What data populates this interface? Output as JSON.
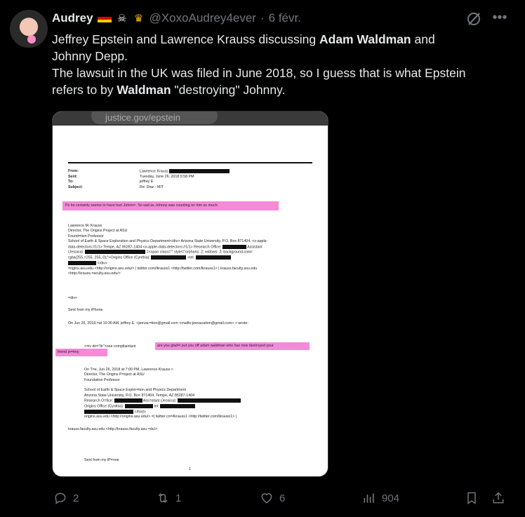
{
  "author": {
    "name": "Audrey",
    "handle": "@XoxoAudrey4ever",
    "separator": "·",
    "date": "6 févr.",
    "badge_emoji": [
      "german-flag",
      "pirate-flag",
      "crown"
    ]
  },
  "tweet_text": {
    "line1_a": "Jeffrey Epstein and Lawrence Krauss discussing ",
    "line1_bold": "Adam Waldman",
    "line1_b": " and",
    "line2": "Johnny Depp.",
    "line3": "The lawsuit in the UK was filed in June 2018, so I guess that is what Epstein",
    "line4_a": "refers to by ",
    "line4_bold": "Waldman",
    "line4_b": " \"destroying\" Johnny."
  },
  "image": {
    "url_bar": "justice.gov/epstein",
    "email": {
      "from_label": "From:",
      "from_value": "Lawrence Krauss",
      "sent_label": "Sent:",
      "sent_value": "Tuesday, June 26, 2018 5:58 PM",
      "to_label": "To:",
      "to_value": "jeffrey E.",
      "subject_label": "Subject:",
      "subject_value": "Re: Diaz - MIT",
      "body_highlight": "Ps he certainly seems to have hurt Johnn=. So sad as Johnny was counting on him so much.",
      "sig1": "Lawrence M. Krauss",
      "sig2": "Director, The Origins Project at ASU",
      "sig3": "Found=tion Professor",
      "sig4": "School of Earth & Space Exploration and Physics Department</div> Arizona State University, P.O. Box 871404, <x-apple-",
      "sig5": "data-detectors://1/1> Tempe, AZ 85287-1404 <x-apple-data-detectors://1/1> Research Office:",
      "sig5b": "Assistant",
      "sig6": "(Jessica):",
      "sig6b": "=<span class=\"\" style=\"orphans: 2; widows: 2; background-color:",
      "sig7": "rgba(255,=255, 255, 0);\">Origins Office (Cynthia):",
      "sig7b": "<tel:",
      "sig8": "</div>",
      "sig9": "=rigins.asu.edu <http://origins.asu.edu/> | twitter.com/lkrauss1 <http://twitter.com/lkrauss1> | krauss.faculty.asu.edu",
      "sig10": "<http://krauss.=aculty.asu.edu/>",
      "div_close": "=div>",
      "sent_from": "Sent from my iPhone",
      "on_line": "On Jun 26, 2018,=at 10:30 AM, jeffrey E. <jeevac=tion@gmail.com <mailto:jeevacation@gmail.com> > wrote:",
      "reply_prefix": "<=iv dir=\"ltr\">one compllaintant",
      "reply_highlight1": "are you glad=i put you off adam waldman who has now destroyed your",
      "reply_highlight2": "friend jo=hny",
      "q1": "On T=e, Jun 26, 2018 at 7:00 PM, Lawrence Krauss <",
      "q2": "Director, The Origins P=oject at ASU",
      "q3": "Foundation Professor",
      "q4": "School of Earth & Space Explor=tion and Physics Department",
      "q5": "Arizona State University, P.O. Bo= 871404, Tempe, AZ 85287-1404",
      "q6": "Research O=fice:",
      "q6b": "Ass=stant (Jessica):",
      "q7": "Origins Office (Cynthia):",
      "q7b": "tel:",
      "q8": "</font>",
      "q9": "origins.asu.edu <http://origins.asu.edu/> =| twitter.co=/lkrauss1 <http://twitter.com/lkrauss1> |",
      "q10": "krauss.faculty.asu.edu <http://krauss.faculty.asu.=du/>",
      "sent_from2": "Sent from my iP=one",
      "page_number": "1"
    }
  },
  "actions": {
    "replies": "2",
    "reposts": "1",
    "likes": "6",
    "views": "904"
  },
  "colors": {
    "background": "#000000",
    "text": "#e7e9ea",
    "muted": "#71767b",
    "highlight": "#f48ad8"
  }
}
